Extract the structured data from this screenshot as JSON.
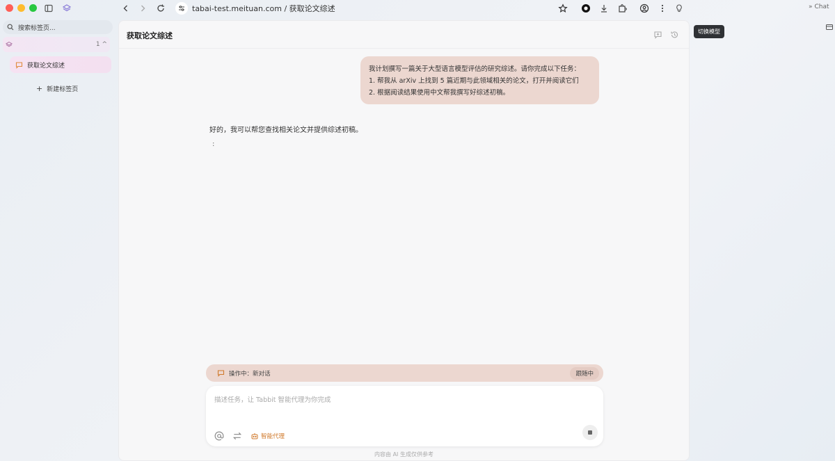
{
  "window": {
    "controls": [
      {
        "name": "close",
        "color": "#ff5f57"
      },
      {
        "name": "minimize",
        "color": "#febc2e"
      },
      {
        "name": "maximize",
        "color": "#28c840"
      }
    ]
  },
  "sidebar": {
    "search_placeholder": "搜索标签页...",
    "space_count": "1 ^",
    "tab_label": "获取论文综述",
    "new_tab_label": "新建标签页"
  },
  "toolbar": {
    "url": "tabai-test.meituan.com / 获取论文综述",
    "tooltip": "切换模型",
    "chat_label": "Chat"
  },
  "main": {
    "title": "获取论文综述",
    "user_message": {
      "line1": "我计划撰写一篇关于大型语言模型评估的研究综述。请你完成以下任务：",
      "line2": "1. 帮我从 arXiv 上找到 5 篇近期与此领域相关的论文，打开并阅读它们",
      "line3": "2. 根据阅读结果使用中文帮我撰写好综述初稿。"
    },
    "assistant_message": "好的，我可以帮您查找相关论文并提供综述初稿。",
    "typing_indicator": ":",
    "status": {
      "label": "操作中：新对话",
      "tag": "跟随中"
    },
    "composer": {
      "placeholder": "描述任务，让 Tabbit 智能代理为你完成",
      "agent_label": "智能代理"
    },
    "footer_note": "内容由 AI 生成仅供参考"
  },
  "colors": {
    "accent": "#d07a2c",
    "bubble": "#ecd7d0",
    "sidebar_active": "#f6e2f2"
  }
}
